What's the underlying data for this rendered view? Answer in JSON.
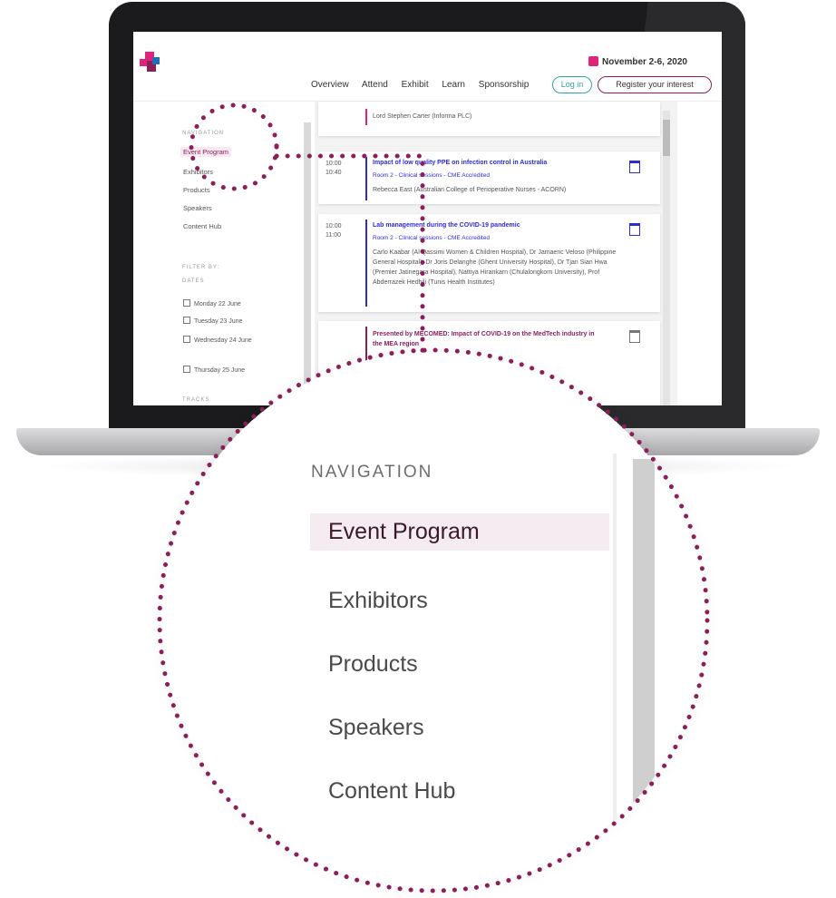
{
  "header": {
    "date": "November 2-6, 2020",
    "nav": [
      "Overview",
      "Attend",
      "Exhibit",
      "Learn",
      "Sponsorship"
    ],
    "login_label": "Log in",
    "register_label": "Register your interest"
  },
  "sidebar": {
    "navigation_label": "NAVIGATION",
    "items": [
      {
        "label": "Event Program"
      },
      {
        "label": "Exhibitors"
      },
      {
        "label": "Products"
      },
      {
        "label": "Speakers"
      },
      {
        "label": "Content Hub"
      }
    ],
    "filter_label": "FILTER BY:",
    "dates_label": "DATES",
    "dates": [
      "Monday 22 June",
      "Tuesday 23 June",
      "Wednesday 24 June",
      "Thursday 25 June"
    ],
    "tracks_label": "TRACKS"
  },
  "sessions": [
    {
      "speakers": "Lord Stephen Carter (Informa PLC)",
      "accent": "#e0237b"
    },
    {
      "time_start": "10:00",
      "time_end": "10:40",
      "title": "Impact of low quality PPE on infection control in Australia",
      "room": "Room 2 - Clinical sessions - CME Accredited",
      "speakers": "Rebecca East (Australian College of Perioperative Nurses - ACORN)",
      "accent": "#2d2dd8"
    },
    {
      "time_start": "10:00",
      "time_end": "11:00",
      "title": "Lab management during the COVID-19 pandemic",
      "room": "Room 2 - Clinical sessions - CME Accredited",
      "speakers": "Carlo Kaabar (Al Qassimi Women & Children Hospital), Dr Jamaeric Veloso (Philippine General Hospital), Dr Joris Delanghe (Ghent University Hospital), Dr Tjan Sian Hwa (Premier Jatinegara Hospital), Nattiya Hirankarn (Chulalongkorn University), Prof Abderrazek Hedhili (Tunis Health Institutes)",
      "accent": "#2d2dd8"
    },
    {
      "title": "Presented by MECOMED: Impact of COVID-19 on the MedTech industry in the MEA region",
      "accent": "#8a1f5a"
    }
  ],
  "zoom": {
    "navigation_label": "NAVIGATION",
    "items": [
      "Event Program",
      "Exhibitors",
      "Products",
      "Speakers",
      "Content Hub"
    ]
  },
  "colors": {
    "brand_magenta": "#e0237b",
    "brand_plum": "#8a1f5a",
    "teal": "#2aa6a0",
    "link_blue": "#2d2dd8"
  }
}
